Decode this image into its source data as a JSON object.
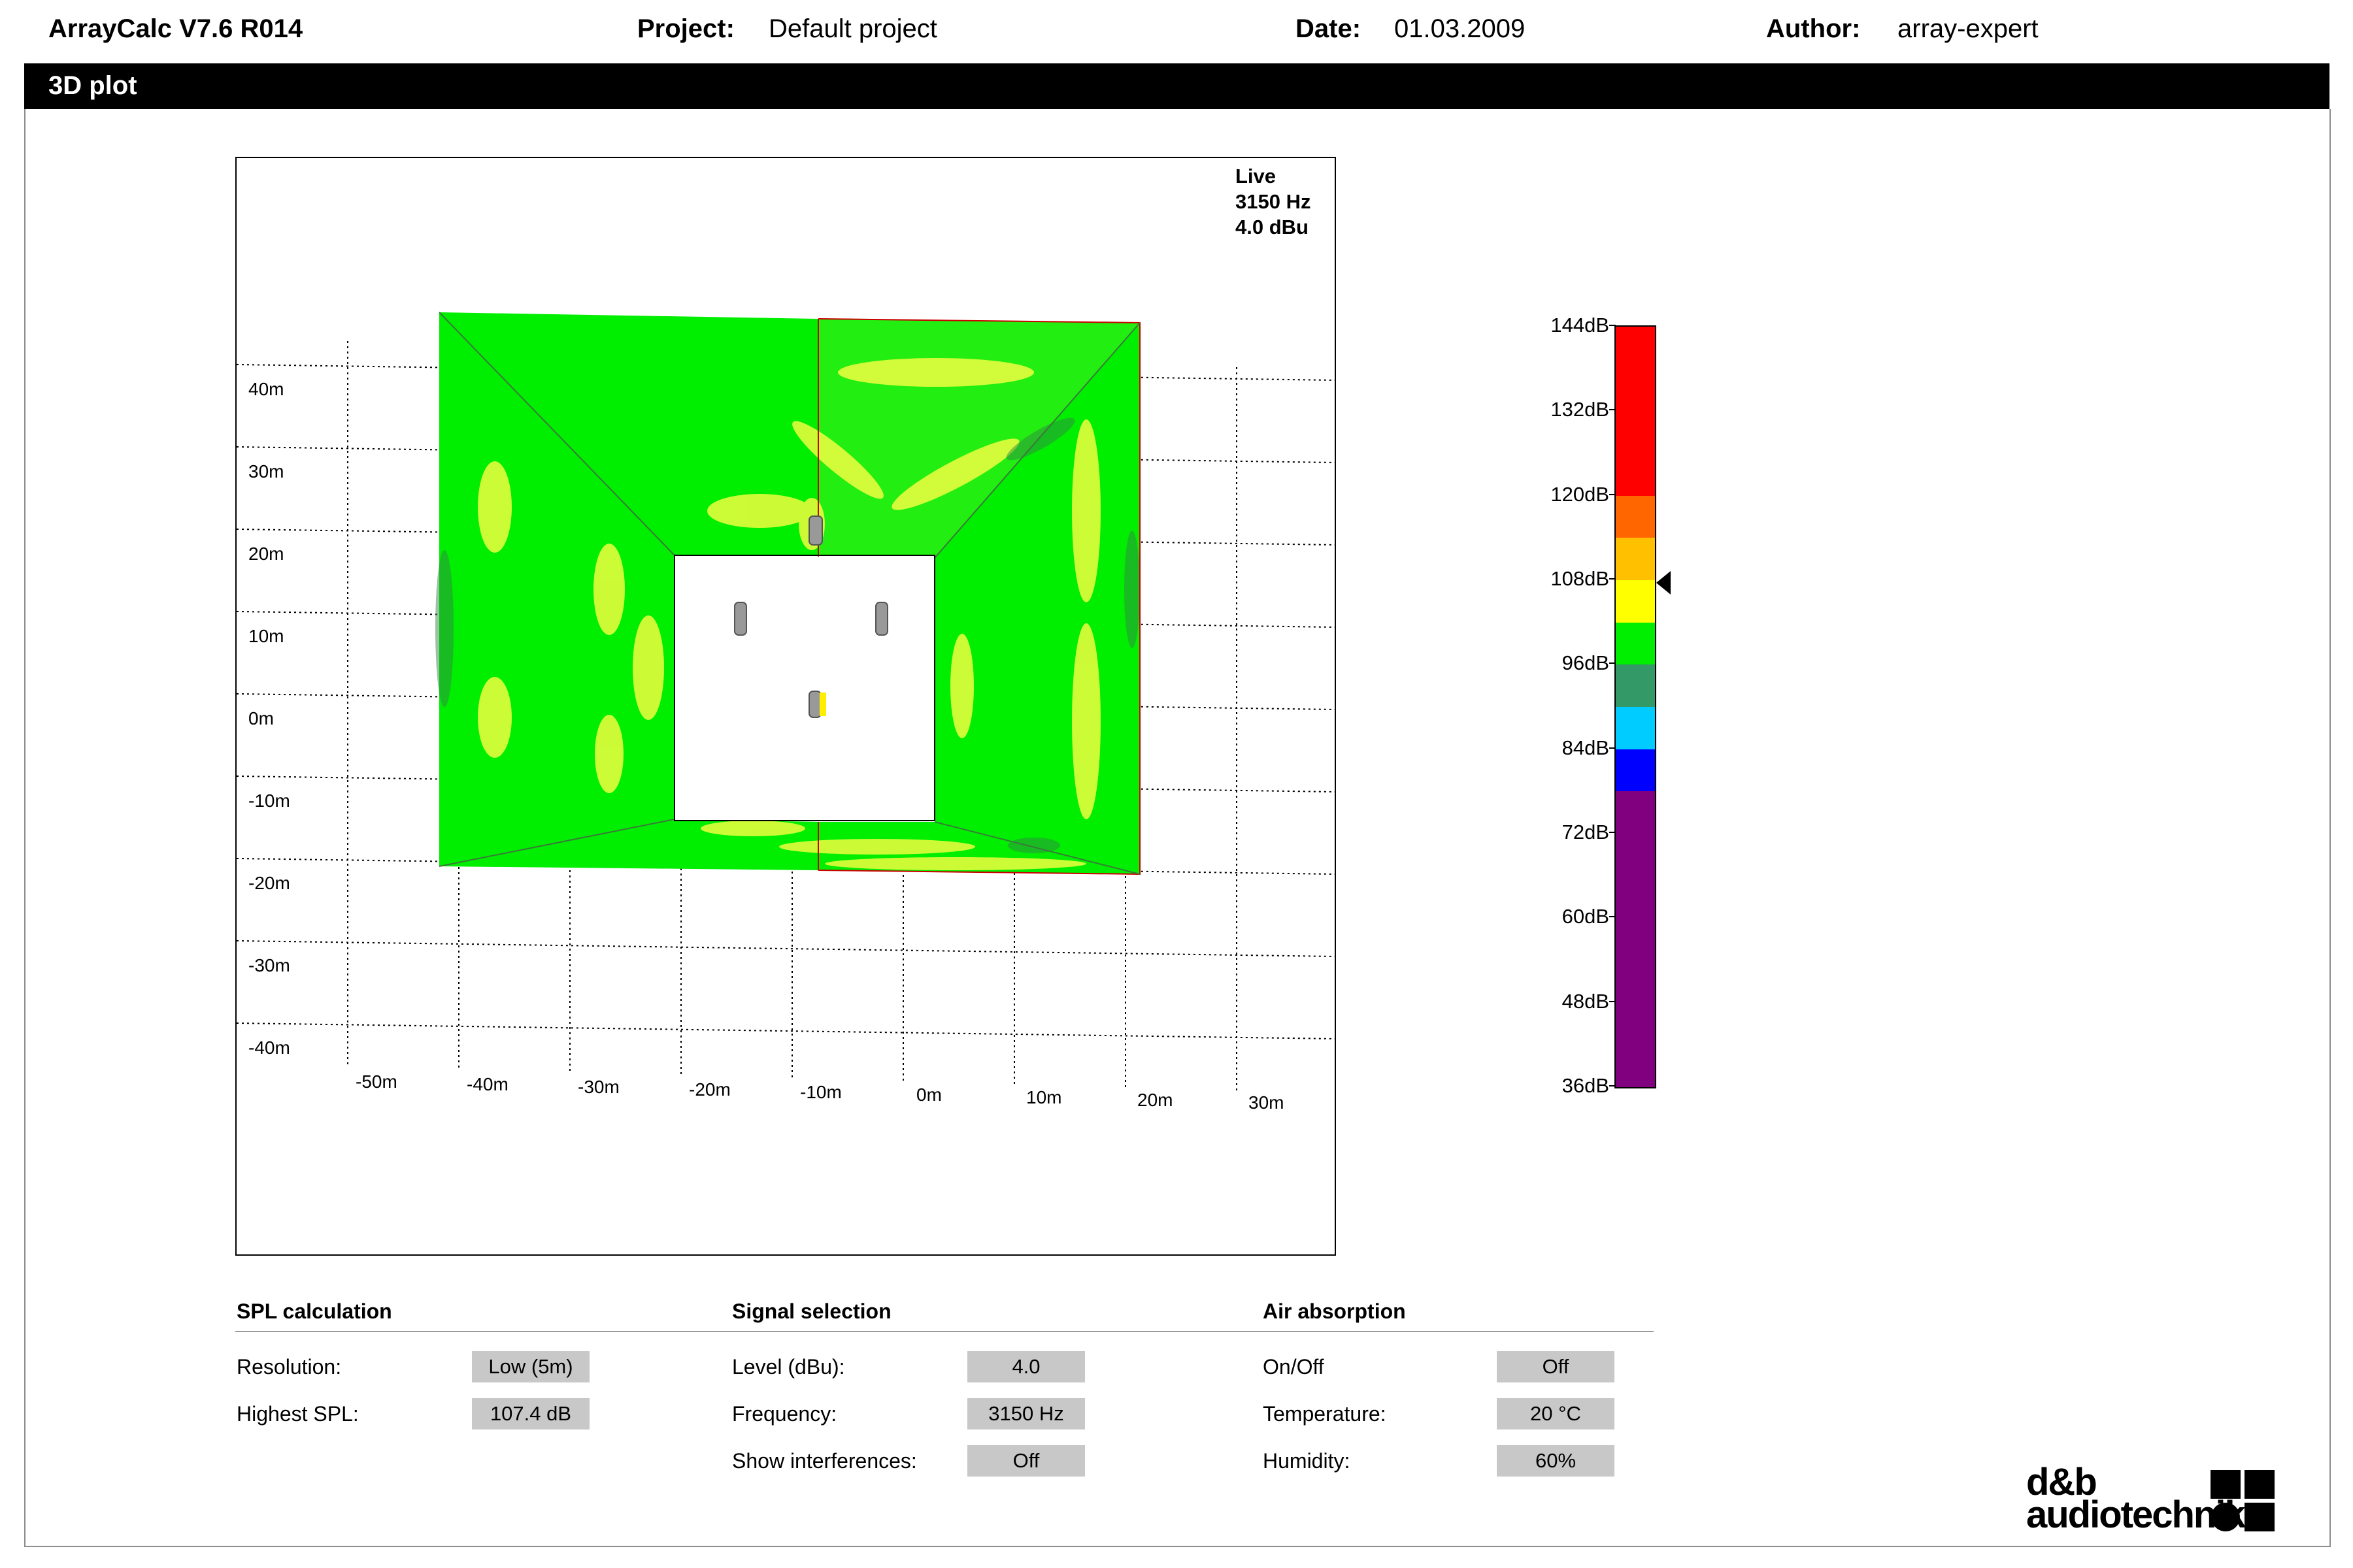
{
  "header": {
    "app_title": "ArrayCalc V7.6 R014",
    "project_label": "Project:",
    "project_value": "Default project",
    "date_label": "Date:",
    "date_value": "01.03.2009",
    "author_label": "Author:",
    "author_value": "array-expert"
  },
  "section_title": "3D plot",
  "plot": {
    "info": [
      "Live",
      "3150 Hz",
      "4.0 dBu"
    ],
    "y_ticks": [
      "40m",
      "30m",
      "20m",
      "10m",
      "0m",
      "-10m",
      "-20m",
      "-30m",
      "-40m"
    ],
    "x_ticks": [
      "-50m",
      "-40m",
      "-30m",
      "-20m",
      "-10m",
      "0m",
      "10m",
      "20m",
      "30m"
    ]
  },
  "color_scale": {
    "labels": [
      "144dB",
      "132dB",
      "120dB",
      "108dB",
      "96dB",
      "84dB",
      "72dB",
      "60dB",
      "48dB",
      "36dB"
    ],
    "bands": [
      {
        "from_db": 120,
        "to_db": 144,
        "color": "#ff0000"
      },
      {
        "from_db": 114,
        "to_db": 120,
        "color": "#ff6600"
      },
      {
        "from_db": 108,
        "to_db": 114,
        "color": "#ffc000"
      },
      {
        "from_db": 102,
        "to_db": 108,
        "color": "#ffff00"
      },
      {
        "from_db": 96,
        "to_db": 102,
        "color": "#00ee00"
      },
      {
        "from_db": 90,
        "to_db": 96,
        "color": "#339966"
      },
      {
        "from_db": 84,
        "to_db": 90,
        "color": "#00ccff"
      },
      {
        "from_db": 78,
        "to_db": 84,
        "color": "#0000ff"
      },
      {
        "from_db": 36,
        "to_db": 78,
        "color": "#800080"
      }
    ],
    "marker_db": 107.4
  },
  "settings": {
    "spl": {
      "title": "SPL calculation",
      "resolution_label": "Resolution:",
      "resolution_value": "Low (5m)",
      "highest_label": "Highest SPL:",
      "highest_value": "107.4 dB"
    },
    "signal": {
      "title": "Signal selection",
      "level_label": "Level (dBu):",
      "level_value": "4.0",
      "freq_label": "Frequency:",
      "freq_value": "3150 Hz",
      "interf_label": "Show interferences:",
      "interf_value": "Off"
    },
    "air": {
      "title": "Air absorption",
      "onoff_label": "On/Off",
      "onoff_value": "Off",
      "temp_label": "Temperature:",
      "temp_value": "20 °C",
      "hum_label": "Humidity:",
      "hum_value": "60%"
    }
  },
  "logo": {
    "line1": "d&b",
    "line2": "audiotechnik"
  }
}
